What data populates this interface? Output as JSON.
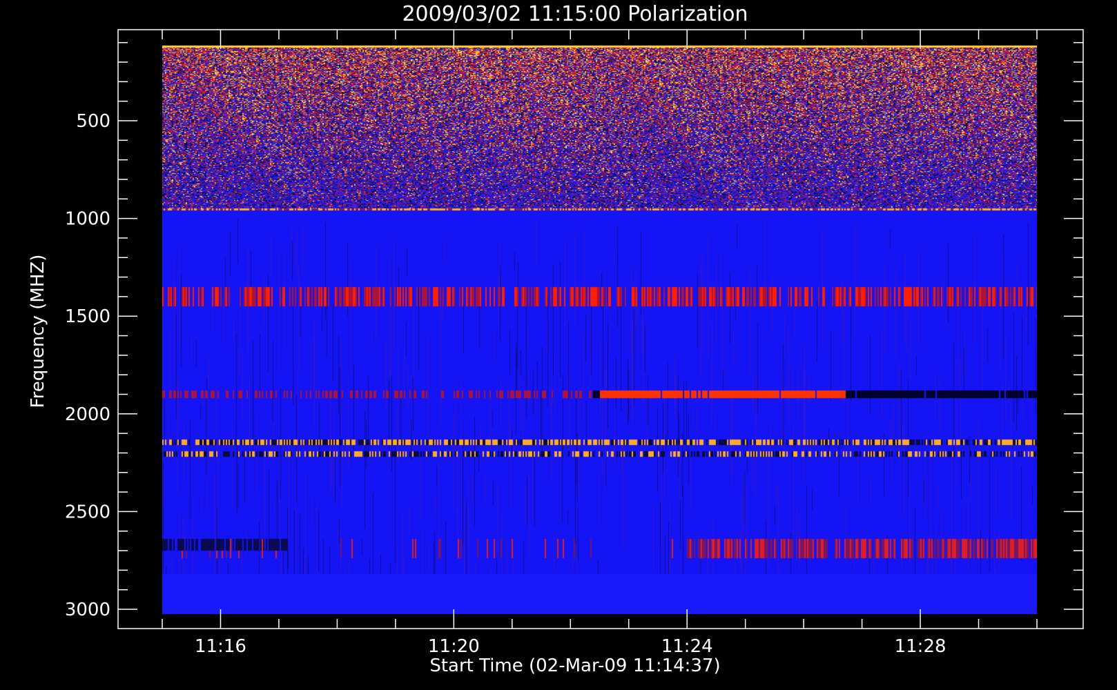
{
  "chart_data": {
    "type": "heatmap",
    "title": "2009/03/02 11:15:00 Polarization",
    "xlabel": "Start Time (02-Mar-09 11:14:37)",
    "ylabel": "Frequency (MHZ)",
    "x_range": [
      "11:15:00",
      "11:30:00"
    ],
    "ylim": [
      3000,
      100
    ],
    "x_ticks": [
      "11:16",
      "11:20",
      "11:24",
      "11:28"
    ],
    "y_ticks": [
      500,
      1000,
      1500,
      2000,
      2500,
      3000
    ],
    "grid": false,
    "colormap": [
      "#0a0a50",
      "#1010ff",
      "#3a2bd0",
      "#b01050",
      "#ff2000",
      "#ffa020",
      "#ffe060"
    ],
    "features": [
      {
        "freq_mhz": [
          100,
          960
        ],
        "description_class": "noisy",
        "level": "mixed"
      },
      {
        "freq_mhz": [
          1350,
          1450
        ],
        "description_class": "band",
        "level": "red"
      },
      {
        "freq_mhz": [
          1900,
          1920
        ],
        "description_class": "band",
        "level": "red/black"
      },
      {
        "freq_mhz": [
          2130,
          2160
        ],
        "description_class": "band",
        "level": "orange"
      },
      {
        "freq_mhz": [
          2190,
          2220
        ],
        "description_class": "band",
        "level": "orange"
      },
      {
        "freq_mhz": [
          2640,
          2740
        ],
        "description_class": "band",
        "level": "red (late)"
      }
    ]
  },
  "colors": {
    "background": "#000000",
    "axis": "#ffffff",
    "base": "#1414f5"
  }
}
